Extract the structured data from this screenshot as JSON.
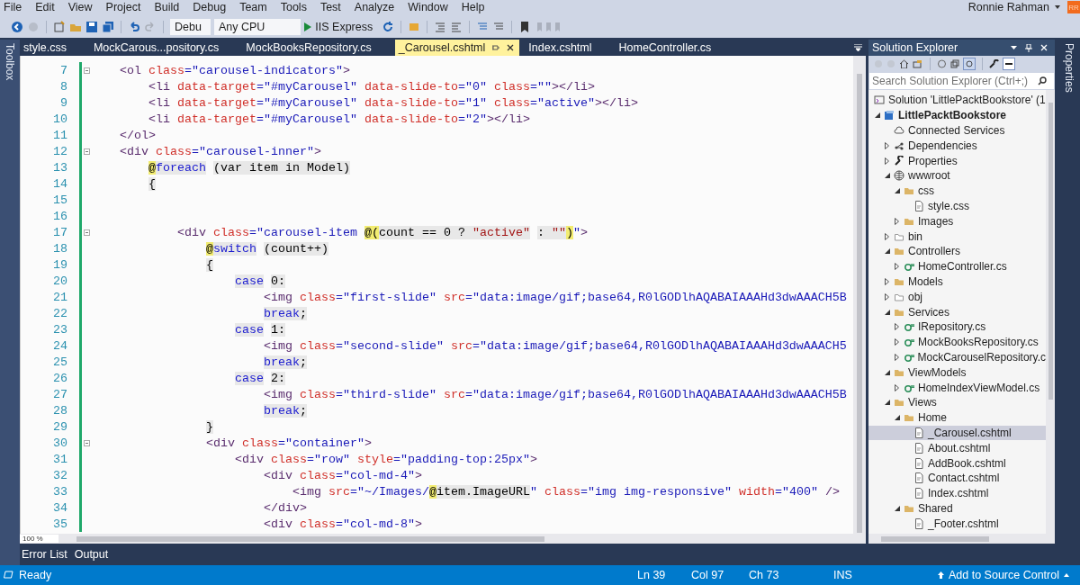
{
  "menu": [
    "File",
    "Edit",
    "View",
    "Project",
    "Build",
    "Debug",
    "Team",
    "Tools",
    "Test",
    "Analyze",
    "Window",
    "Help"
  ],
  "account": {
    "name": "Ronnie Rahman",
    "initials": "RR"
  },
  "toolbar": {
    "configuration": "Debu",
    "platform": "Any CPU",
    "run_target": "IIS Express"
  },
  "side_tabs": {
    "left": "Toolbox",
    "right": "Properties"
  },
  "tabs": [
    {
      "label": "style.css",
      "selected": false
    },
    {
      "label": "MockCarous...pository.cs",
      "selected": false
    },
    {
      "label": "MockBooksRepository.cs",
      "selected": false
    },
    {
      "label": "_Carousel.cshtml",
      "selected": true
    },
    {
      "label": "Index.cshtml",
      "selected": false
    },
    {
      "label": "HomeController.cs",
      "selected": false
    }
  ],
  "editor": {
    "zoom": "100 %",
    "lines": [
      {
        "number": "7",
        "fold_marker": true,
        "tokens": [
          {
            "kind": "tag",
            "text": "    <ol"
          },
          {
            "kind": "attr",
            "text": " class"
          },
          {
            "kind": "value",
            "text": "=\"carousel-indicators\""
          },
          {
            "kind": "tag",
            "text": ">"
          }
        ]
      },
      {
        "number": "8",
        "fold_marker": false,
        "tokens": [
          {
            "kind": "tag",
            "text": "        <li"
          },
          {
            "kind": "attr",
            "text": " data-target"
          },
          {
            "kind": "value",
            "text": "=\"#myCarousel\""
          },
          {
            "kind": "attr",
            "text": " data-slide-to"
          },
          {
            "kind": "value",
            "text": "=\"0\""
          },
          {
            "kind": "attr",
            "text": " class"
          },
          {
            "kind": "value",
            "text": "=\"\""
          },
          {
            "kind": "tag",
            "text": "></li>"
          }
        ]
      },
      {
        "number": "9",
        "fold_marker": false,
        "tokens": [
          {
            "kind": "tag",
            "text": "        <li"
          },
          {
            "kind": "attr",
            "text": " data-target"
          },
          {
            "kind": "value",
            "text": "=\"#myCarousel\""
          },
          {
            "kind": "attr",
            "text": " data-slide-to"
          },
          {
            "kind": "value",
            "text": "=\"1\""
          },
          {
            "kind": "attr",
            "text": " class"
          },
          {
            "kind": "value",
            "text": "=\"active\""
          },
          {
            "kind": "tag",
            "text": "></li>"
          }
        ]
      },
      {
        "number": "10",
        "fold_marker": false,
        "tokens": [
          {
            "kind": "tag",
            "text": "        <li"
          },
          {
            "kind": "attr",
            "text": " data-target"
          },
          {
            "kind": "value",
            "text": "=\"#myCarousel\""
          },
          {
            "kind": "attr",
            "text": " data-slide-to"
          },
          {
            "kind": "value",
            "text": "=\"2\""
          },
          {
            "kind": "tag",
            "text": "></li>"
          }
        ]
      },
      {
        "number": "11",
        "fold_marker": false,
        "tokens": [
          {
            "kind": "tag",
            "text": "    </ol>"
          }
        ]
      },
      {
        "number": "12",
        "fold_marker": true,
        "tokens": [
          {
            "kind": "tag",
            "text": "    <div"
          },
          {
            "kind": "attr",
            "text": " class"
          },
          {
            "kind": "value",
            "text": "=\"carousel-inner\""
          },
          {
            "kind": "tag",
            "text": ">"
          }
        ]
      },
      {
        "number": "13",
        "fold_marker": false,
        "tokens": [
          {
            "kind": "razor",
            "text": "        @"
          },
          {
            "kind": "keyword",
            "text": "foreach"
          },
          {
            "kind": "expr",
            "text": " (var item in Model)"
          }
        ]
      },
      {
        "number": "14",
        "fold_marker": false,
        "tokens": [
          {
            "kind": "expr",
            "text": "        {"
          }
        ]
      },
      {
        "number": "15",
        "fold_marker": false
      },
      {
        "number": "16",
        "fold_marker": false
      },
      {
        "number": "17",
        "fold_marker": true,
        "tokens": [
          {
            "kind": "tag",
            "text": "            <div"
          },
          {
            "kind": "attr",
            "text": " class"
          },
          {
            "kind": "value",
            "text": "=\"carousel-item "
          },
          {
            "kind": "razor",
            "text": "@("
          },
          {
            "kind": "expr",
            "text": "count == 0 ? "
          },
          {
            "kind": "string",
            "text": "\"active\""
          },
          {
            "kind": "expr",
            "text": " : "
          },
          {
            "kind": "string",
            "text": "\"\""
          },
          {
            "kind": "razor",
            "text": ")"
          },
          {
            "kind": "value",
            "text": "\""
          },
          {
            "kind": "tag",
            "text": ">"
          }
        ]
      },
      {
        "number": "18",
        "fold_marker": false,
        "tokens": [
          {
            "kind": "razor",
            "text": "                @"
          },
          {
            "kind": "keyword",
            "text": "switch"
          },
          {
            "kind": "expr",
            "text": " (count++)"
          }
        ]
      },
      {
        "number": "19",
        "fold_marker": false,
        "tokens": [
          {
            "kind": "expr",
            "text": "                {"
          }
        ]
      },
      {
        "number": "20",
        "fold_marker": false,
        "tokens": [
          {
            "kind": "keyword",
            "text": "                    case"
          },
          {
            "kind": "expr",
            "text": " 0:"
          }
        ]
      },
      {
        "number": "21",
        "fold_marker": false,
        "tokens": [
          {
            "kind": "tag",
            "text": "                        <img"
          },
          {
            "kind": "attr",
            "text": " class"
          },
          {
            "kind": "value",
            "text": "=\"first-slide\""
          },
          {
            "kind": "attr",
            "text": " src"
          },
          {
            "kind": "value",
            "text": "=\"data:image/gif;base64,R0lGODlhAQABAIAAAHd3dwAAACH5B"
          }
        ]
      },
      {
        "number": "22",
        "fold_marker": false,
        "tokens": [
          {
            "kind": "keyword",
            "text": "                        break"
          },
          {
            "kind": "expr",
            "text": ";"
          }
        ]
      },
      {
        "number": "23",
        "fold_marker": false,
        "tokens": [
          {
            "kind": "keyword",
            "text": "                    case"
          },
          {
            "kind": "expr",
            "text": " 1:"
          }
        ]
      },
      {
        "number": "24",
        "fold_marker": false,
        "tokens": [
          {
            "kind": "tag",
            "text": "                        <img"
          },
          {
            "kind": "attr",
            "text": " class"
          },
          {
            "kind": "value",
            "text": "=\"second-slide\""
          },
          {
            "kind": "attr",
            "text": " src"
          },
          {
            "kind": "value",
            "text": "=\"data:image/gif;base64,R0lGODlhAQABAIAAAHd3dwAAACH5"
          }
        ]
      },
      {
        "number": "25",
        "fold_marker": false,
        "tokens": [
          {
            "kind": "keyword",
            "text": "                        break"
          },
          {
            "kind": "expr",
            "text": ";"
          }
        ]
      },
      {
        "number": "26",
        "fold_marker": false,
        "tokens": [
          {
            "kind": "keyword",
            "text": "                    case"
          },
          {
            "kind": "expr",
            "text": " 2:"
          }
        ]
      },
      {
        "number": "27",
        "fold_marker": false,
        "tokens": [
          {
            "kind": "tag",
            "text": "                        <img"
          },
          {
            "kind": "attr",
            "text": " class"
          },
          {
            "kind": "value",
            "text": "=\"third-slide\""
          },
          {
            "kind": "attr",
            "text": " src"
          },
          {
            "kind": "value",
            "text": "=\"data:image/gif;base64,R0lGODlhAQABAIAAAHd3dwAAACH5B"
          }
        ]
      },
      {
        "number": "28",
        "fold_marker": false,
        "tokens": [
          {
            "kind": "keyword",
            "text": "                        break"
          },
          {
            "kind": "expr",
            "text": ";"
          }
        ]
      },
      {
        "number": "29",
        "fold_marker": false,
        "tokens": [
          {
            "kind": "expr",
            "text": "                }"
          }
        ]
      },
      {
        "number": "30",
        "fold_marker": true,
        "tokens": [
          {
            "kind": "tag",
            "text": "                <div"
          },
          {
            "kind": "attr",
            "text": " class"
          },
          {
            "kind": "value",
            "text": "=\"container\""
          },
          {
            "kind": "tag",
            "text": ">"
          }
        ]
      },
      {
        "number": "31",
        "fold_marker": false,
        "tokens": [
          {
            "kind": "tag",
            "text": "                    <div"
          },
          {
            "kind": "attr",
            "text": " class"
          },
          {
            "kind": "value",
            "text": "=\"row\""
          },
          {
            "kind": "attr",
            "text": " style"
          },
          {
            "kind": "value",
            "text": "=\"padding-top:25px\""
          },
          {
            "kind": "tag",
            "text": ">"
          }
        ]
      },
      {
        "number": "32",
        "fold_marker": false,
        "tokens": [
          {
            "kind": "tag",
            "text": "                        <div"
          },
          {
            "kind": "attr",
            "text": " class"
          },
          {
            "kind": "value",
            "text": "=\"col-md-4\""
          },
          {
            "kind": "tag",
            "text": ">"
          }
        ]
      },
      {
        "number": "33",
        "fold_marker": false,
        "tokens": [
          {
            "kind": "tag",
            "text": "                            <img"
          },
          {
            "kind": "attr",
            "text": " src"
          },
          {
            "kind": "value",
            "text": "=\"~/Images/"
          },
          {
            "kind": "razor",
            "text": "@"
          },
          {
            "kind": "expr",
            "text": "item.ImageURL"
          },
          {
            "kind": "value",
            "text": "\""
          },
          {
            "kind": "attr",
            "text": " class"
          },
          {
            "kind": "value",
            "text": "=\"img img-responsive\""
          },
          {
            "kind": "attr",
            "text": " width"
          },
          {
            "kind": "value",
            "text": "=\"400\""
          },
          {
            "kind": "tag",
            "text": " />"
          }
        ]
      },
      {
        "number": "34",
        "fold_marker": false,
        "tokens": [
          {
            "kind": "tag",
            "text": "                        </div>"
          }
        ]
      },
      {
        "number": "35",
        "fold_marker": false,
        "tokens": [
          {
            "kind": "tag",
            "text": "                        <div"
          },
          {
            "kind": "attr",
            "text": " class"
          },
          {
            "kind": "value",
            "text": "=\"col-md-8\""
          },
          {
            "kind": "tag",
            "text": ">"
          }
        ]
      }
    ]
  },
  "solution_explorer": {
    "title": "Solution Explorer",
    "search": {
      "placeholder": "Search Solution Explorer (Ctrl+;)"
    },
    "tree": [
      {
        "label": "Solution 'LittlePacktBookstore' (1",
        "kind": "solution",
        "selected": false,
        "children": [
          {
            "label": "LittlePacktBookstore",
            "kind": "project",
            "expanded": true,
            "selected": false,
            "children": [
              {
                "label": "Connected Services",
                "kind": "cloud",
                "selected": false
              },
              {
                "label": "Dependencies",
                "kind": "deps",
                "expanded": false,
                "selected": false
              },
              {
                "label": "Properties",
                "kind": "wrench",
                "expanded": false,
                "selected": false
              },
              {
                "label": "wwwroot",
                "kind": "globe",
                "expanded": true,
                "selected": false,
                "children": [
                  {
                    "label": "css",
                    "kind": "folder",
                    "expanded": true,
                    "selected": false,
                    "children": [
                      {
                        "label": "style.css",
                        "kind": "file",
                        "selected": false
                      }
                    ]
                  },
                  {
                    "label": "Images",
                    "kind": "folder",
                    "expanded": false,
                    "selected": false
                  }
                ]
              },
              {
                "label": "bin",
                "kind": "empty-folder",
                "expanded": false,
                "selected": false
              },
              {
                "label": "Controllers",
                "kind": "folder",
                "expanded": true,
                "selected": false,
                "children": [
                  {
                    "label": "HomeController.cs",
                    "kind": "csharp",
                    "expanded": false,
                    "selected": false
                  }
                ]
              },
              {
                "label": "Models",
                "kind": "folder",
                "expanded": false,
                "selected": false
              },
              {
                "label": "obj",
                "kind": "empty-folder",
                "expanded": false,
                "selected": false
              },
              {
                "label": "Services",
                "kind": "folder",
                "expanded": true,
                "selected": false,
                "children": [
                  {
                    "label": "IRepository.cs",
                    "kind": "csharp",
                    "expanded": false,
                    "selected": false
                  },
                  {
                    "label": "MockBooksRepository.cs",
                    "kind": "csharp",
                    "expanded": false,
                    "selected": false
                  },
                  {
                    "label": "MockCarouselRepository.c",
                    "kind": "csharp",
                    "expanded": false,
                    "selected": false
                  }
                ]
              },
              {
                "label": "ViewModels",
                "kind": "folder",
                "expanded": true,
                "selected": false,
                "children": [
                  {
                    "label": "HomeIndexViewModel.cs",
                    "kind": "csharp",
                    "expanded": false,
                    "selected": false
                  }
                ]
              },
              {
                "label": "Views",
                "kind": "folder",
                "expanded": true,
                "selected": false,
                "children": [
                  {
                    "label": "Home",
                    "kind": "folder",
                    "expanded": true,
                    "selected": false,
                    "children": [
                      {
                        "label": "_Carousel.cshtml",
                        "kind": "file",
                        "selected": true
                      },
                      {
                        "label": "About.cshtml",
                        "kind": "file",
                        "selected": false
                      },
                      {
                        "label": "AddBook.cshtml",
                        "kind": "file",
                        "selected": false
                      },
                      {
                        "label": "Contact.cshtml",
                        "kind": "file",
                        "selected": false
                      },
                      {
                        "label": "Index.cshtml",
                        "kind": "file",
                        "selected": false
                      }
                    ]
                  },
                  {
                    "label": "Shared",
                    "kind": "folder",
                    "expanded": true,
                    "selected": false,
                    "children": [
                      {
                        "label": "_Footer.cshtml",
                        "kind": "file",
                        "selected": false
                      }
                    ]
                  }
                ]
              }
            ]
          }
        ]
      }
    ]
  },
  "bottom_tabs": [
    "Error List",
    "Output"
  ],
  "status_bar": {
    "state": "Ready",
    "line": "Ln 39",
    "column": "Col 97",
    "char": "Ch 73",
    "mode": "INS",
    "source_control": "Add to Source Control"
  }
}
